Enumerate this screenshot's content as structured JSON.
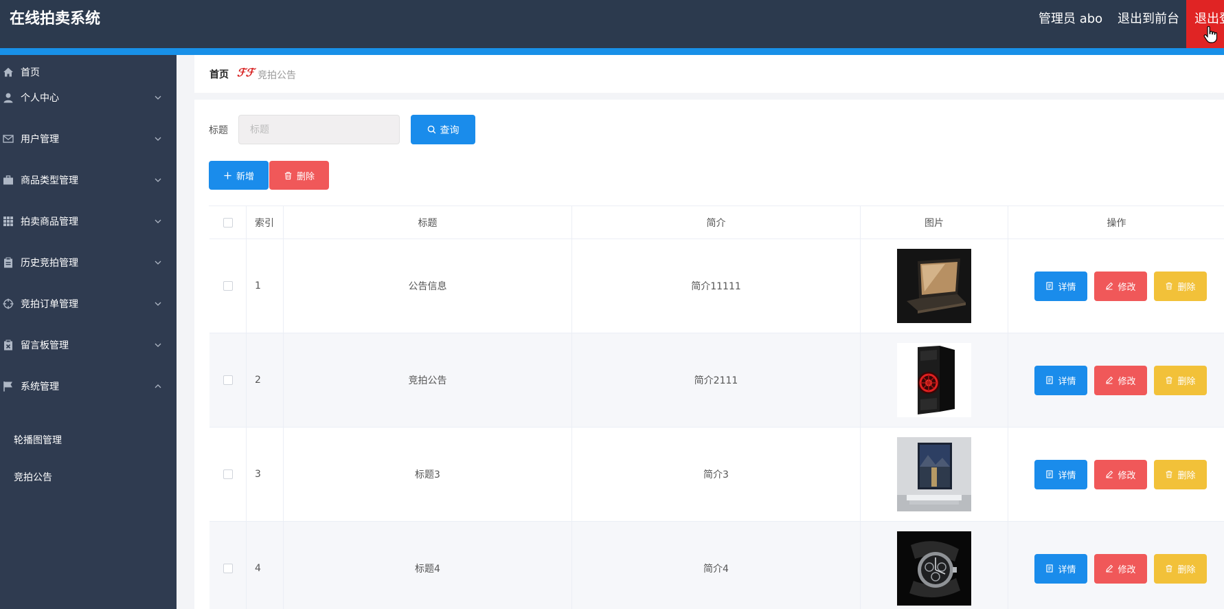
{
  "header": {
    "app_title": "在线拍卖系统",
    "user_label": "管理员 abo",
    "front_link": "退出到前台",
    "logout_label": "退出登录"
  },
  "sidebar": {
    "items": [
      {
        "label": "首页",
        "icon": "home-icon"
      },
      {
        "label": "个人中心",
        "icon": "user-icon"
      },
      {
        "label": "用户管理",
        "icon": "envelope-icon"
      },
      {
        "label": "商品类型管理",
        "icon": "briefcase-icon"
      },
      {
        "label": "拍卖商品管理",
        "icon": "grid-icon"
      },
      {
        "label": "历史竞拍管理",
        "icon": "clipboard-icon"
      },
      {
        "label": "竞拍订单管理",
        "icon": "crosshair-icon"
      },
      {
        "label": "留言板管理",
        "icon": "clipboard-x-icon"
      },
      {
        "label": "系统管理",
        "icon": "flag-icon"
      }
    ],
    "sub_items": [
      {
        "label": "轮播图管理"
      },
      {
        "label": "竞拍公告"
      }
    ]
  },
  "breadcrumb": {
    "home": "首页",
    "separator": "ℱℱ",
    "current": "竞拍公告"
  },
  "search": {
    "label": "标题",
    "placeholder": "标题",
    "value": "",
    "query_button": "查询"
  },
  "toolbar": {
    "add_label": "新增",
    "delete_label": "删除"
  },
  "table": {
    "columns": [
      "索引",
      "标题",
      "简介",
      "图片",
      "操作"
    ],
    "rows": [
      {
        "index": "1",
        "title": "公告信息",
        "intro": "简介11111",
        "image": "laptop"
      },
      {
        "index": "2",
        "title": "竞拍公告",
        "intro": "简介2111",
        "image": "pc-tower"
      },
      {
        "index": "3",
        "title": "标题3",
        "intro": "简介3",
        "image": "wall-painting"
      },
      {
        "index": "4",
        "title": "标题4",
        "intro": "简介4",
        "image": "wristwatch"
      }
    ],
    "actions": {
      "detail": "详情",
      "edit": "修改",
      "delete": "删除"
    }
  },
  "colors": {
    "topbar": "#2c3a4e",
    "accent": "#1890e8",
    "sidebar": "#2f3b50",
    "primary": "#1a8ceb",
    "danger": "#f05859",
    "warning": "#f2c139",
    "logout": "#e02424"
  }
}
